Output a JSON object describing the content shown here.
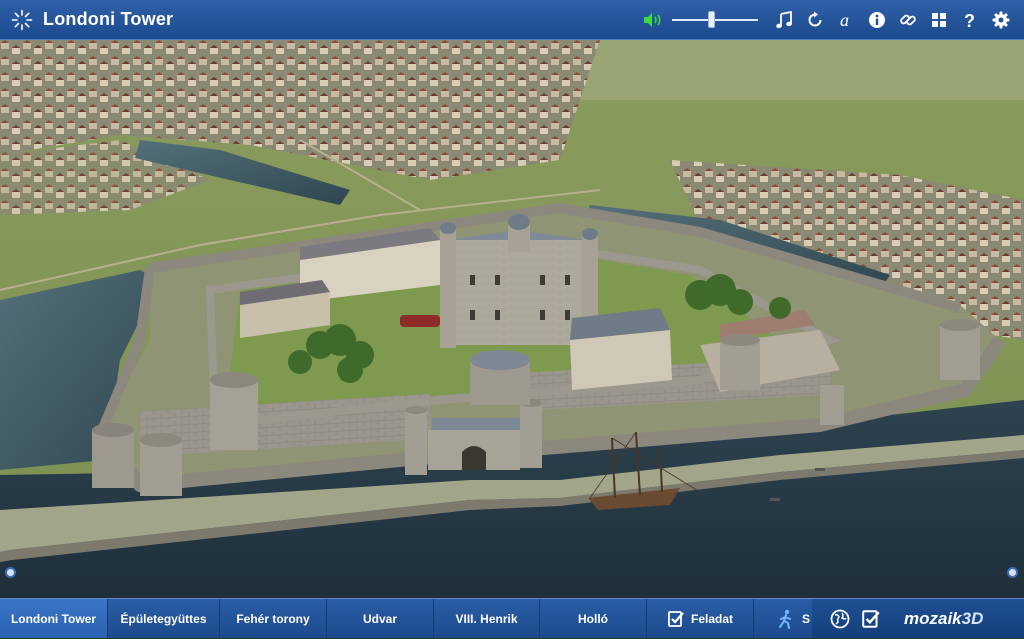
{
  "header": {
    "title": "Londoni Tower",
    "logo_icon": "sunburst-logo-icon",
    "volume_level": 0.45
  },
  "toolbar": {
    "icons": [
      "speaker-icon",
      "music-note-icon",
      "replay-icon",
      "font-a-icon",
      "info-icon",
      "link-icon",
      "grid-icon",
      "help-icon",
      "gear-icon"
    ]
  },
  "tabs": [
    {
      "label": "Londoni Tower",
      "active": true
    },
    {
      "label": "Épületegyüttes"
    },
    {
      "label": "Fehér torony"
    },
    {
      "label": "Udvar"
    },
    {
      "label": "VIII. Henrik"
    },
    {
      "label": "Holló"
    },
    {
      "label": "Feladat",
      "icon": "checklist-icon"
    },
    {
      "label": "S",
      "icon": "walker-icon"
    }
  ],
  "footer": {
    "brand_main": "mozaik",
    "brand_3d": "3D",
    "icons": [
      "globe-icon",
      "checklist-icon"
    ]
  },
  "colors": {
    "header_bg": "#2553a0",
    "active_tab": "#3168b8",
    "accent_green": "#3cdc3c"
  }
}
